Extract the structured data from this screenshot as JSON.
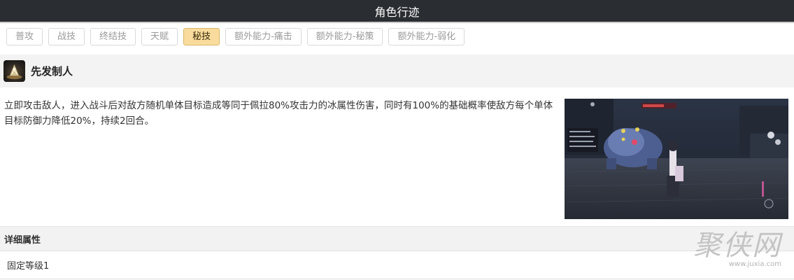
{
  "header": {
    "title": "角色行迹"
  },
  "tabs": [
    {
      "label": "普攻",
      "active": false
    },
    {
      "label": "战技",
      "active": false
    },
    {
      "label": "终结技",
      "active": false
    },
    {
      "label": "天赋",
      "active": false
    },
    {
      "label": "秘技",
      "active": true
    },
    {
      "label": "额外能力-痛击",
      "active": false
    },
    {
      "label": "额外能力-秘策",
      "active": false
    },
    {
      "label": "额外能力-弱化",
      "active": false
    }
  ],
  "skill": {
    "icon": "skill-icon",
    "name": "先发制人",
    "description": "立即攻击敌人，进入战斗后对敌方随机单体目标造成等同于佩拉80%攻击力的冰属性伤害，同时有100%的基础概率使敌方每个单体目标防御力降低20%，持续2回合。"
  },
  "attributes": {
    "heading": "详细属性",
    "rows": [
      {
        "text": "固定等级1"
      }
    ]
  },
  "watermark": {
    "text": "聚侠网",
    "url": "www.juxia.com"
  },
  "colors": {
    "header_bg": "#2a2d31",
    "active_tab_bg": "#f9dc9d",
    "section_bg": "#f3f3f3"
  }
}
